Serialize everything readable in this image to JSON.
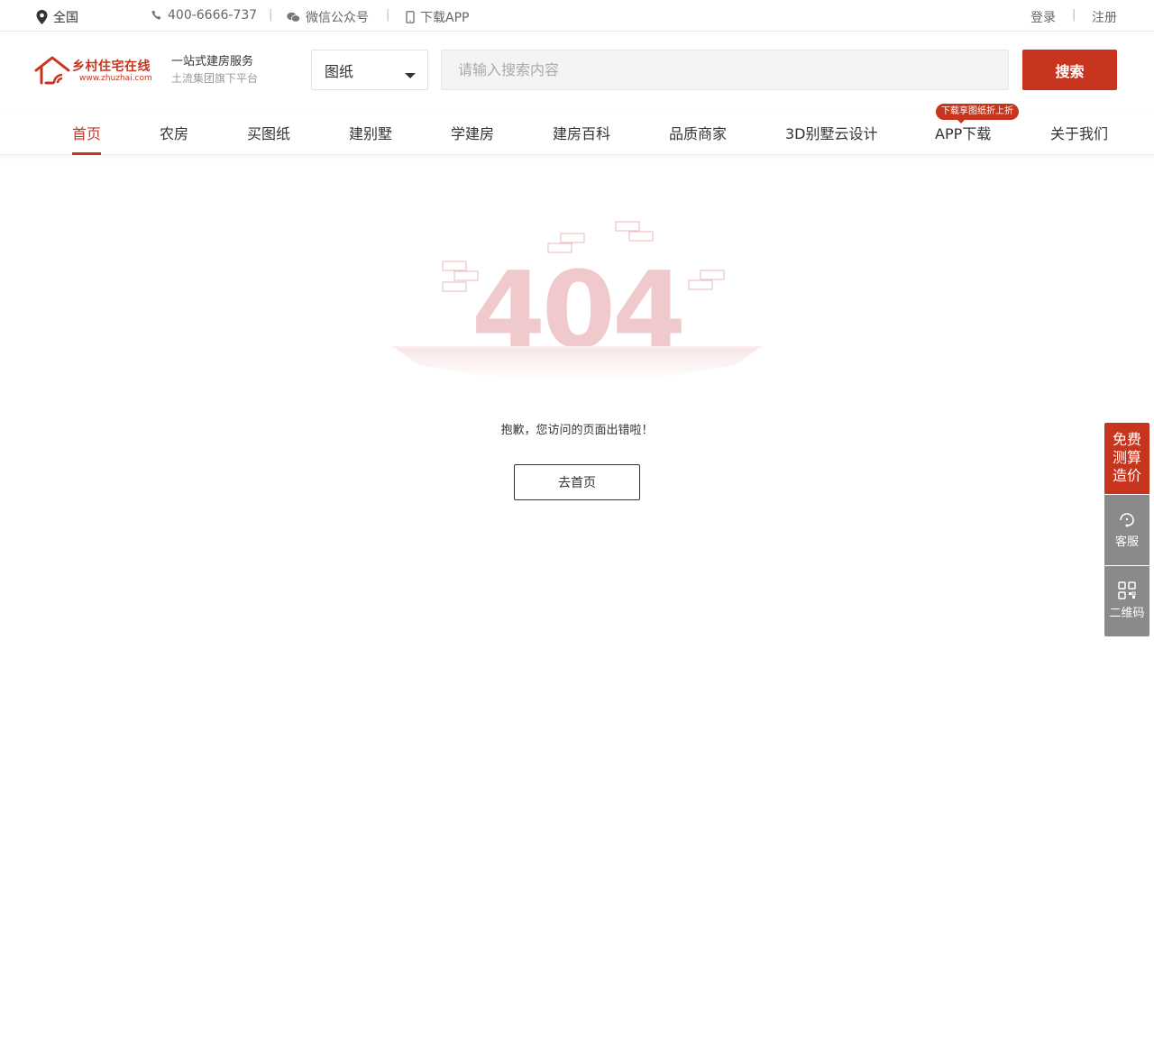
{
  "topbar": {
    "location": "全国",
    "phone": "400-6666-737",
    "wechat": "微信公众号",
    "app": "下载APP",
    "login": "登录",
    "register": "注册",
    "separator": "|"
  },
  "header": {
    "logo_title": "乡村住宅在线",
    "logo_url": "www.zhuzhai.com",
    "slogan_main": "一站式建房服务",
    "slogan_sub": "土流集团旗下平台",
    "search_type": "图纸",
    "search_placeholder": "请输入搜索内容",
    "search_button": "搜索"
  },
  "nav": {
    "items": [
      {
        "label": "首页",
        "active": true
      },
      {
        "label": "农房"
      },
      {
        "label": "买图纸"
      },
      {
        "label": "建别墅"
      },
      {
        "label": "学建房"
      },
      {
        "label": "建房百科"
      },
      {
        "label": "品质商家"
      },
      {
        "label": "3D别墅云设计"
      },
      {
        "label": "APP下载"
      },
      {
        "label": "关于我们"
      }
    ],
    "app_badge": "下载享图纸折上折"
  },
  "error": {
    "code": "404",
    "message": "抱歉，您访问的页面出错啦！",
    "home_button": "去首页"
  },
  "side": {
    "quote_lines": [
      "免费",
      "测算",
      "造价"
    ],
    "service": "客服",
    "qrcode": "二维码"
  },
  "colors": {
    "brand": "#c8351f",
    "side_gray": "#8a8a8a",
    "err_pink": "#f0c9cc"
  },
  "icons": {
    "location": "map-pin-icon",
    "phone": "phone-icon",
    "wechat": "wechat-icon",
    "mobile": "mobile-icon",
    "service": "headset-icon",
    "qrcode": "qrcode-icon",
    "caret": "caret-down-icon"
  }
}
